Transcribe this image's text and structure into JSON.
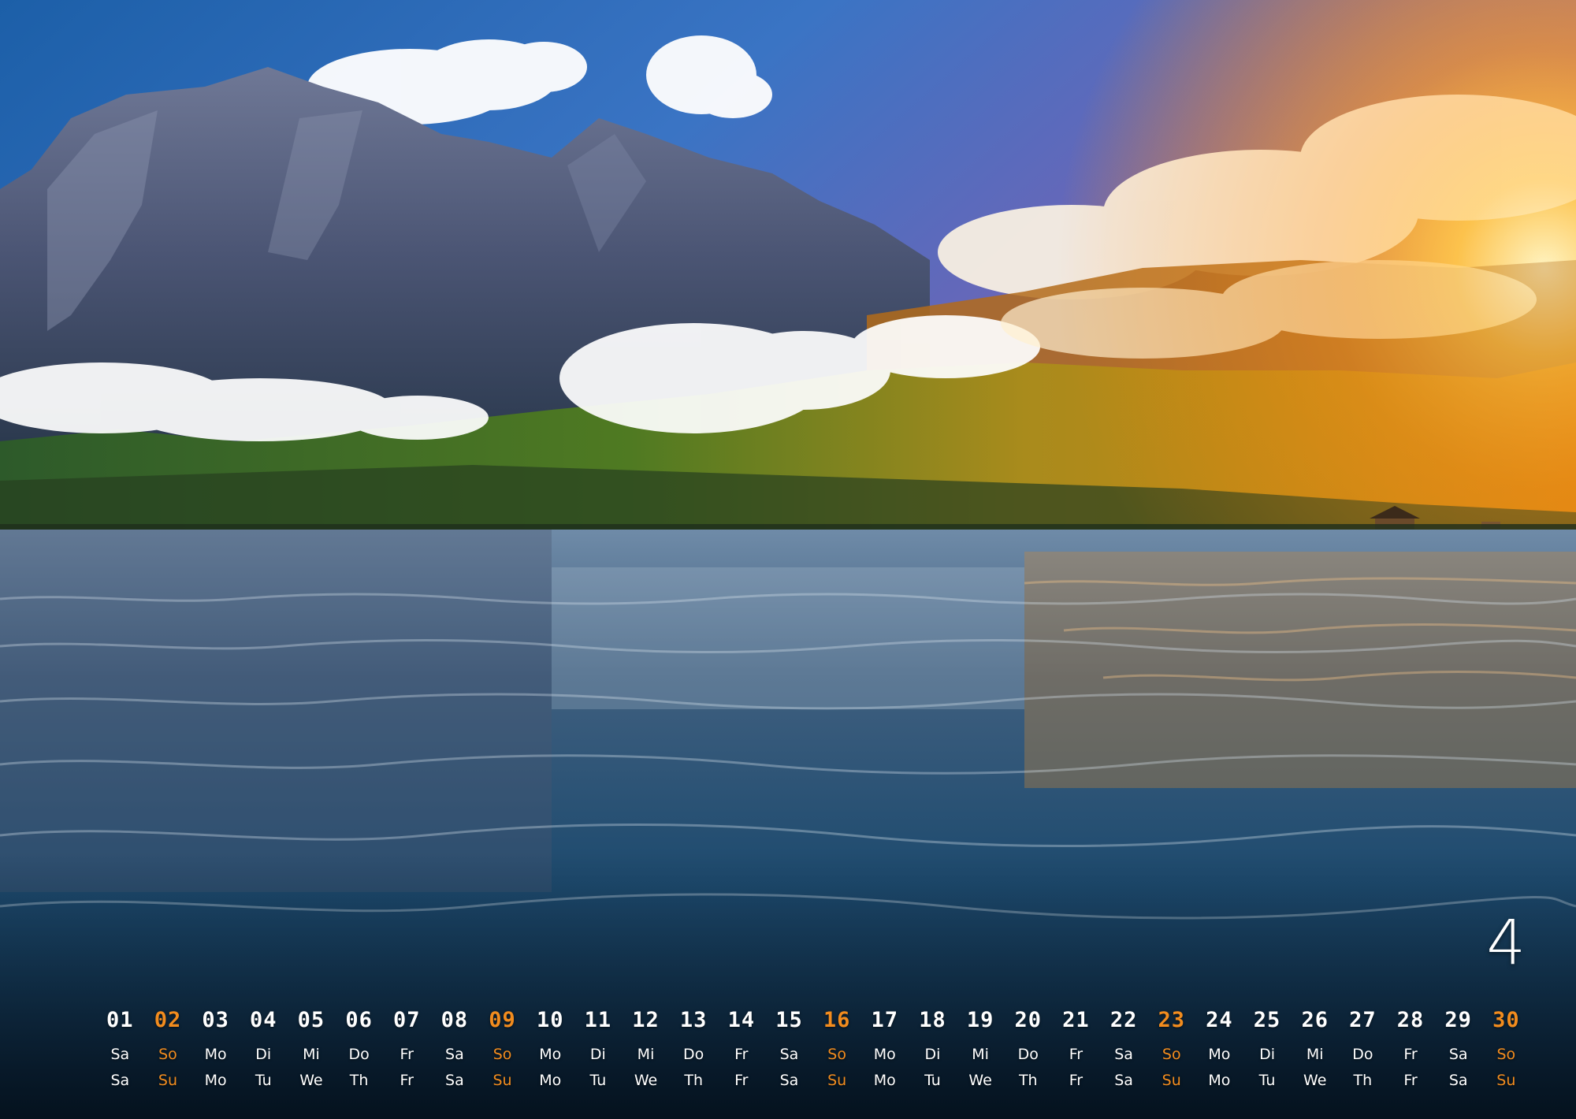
{
  "month": "4",
  "colors": {
    "weekend_accent": "#f28c1e",
    "text": "#ffffff"
  },
  "days": [
    {
      "num": "01",
      "de": "Sa",
      "en": "Sa",
      "sunday": false
    },
    {
      "num": "02",
      "de": "So",
      "en": "Su",
      "sunday": true
    },
    {
      "num": "03",
      "de": "Mo",
      "en": "Mo",
      "sunday": false
    },
    {
      "num": "04",
      "de": "Di",
      "en": "Tu",
      "sunday": false
    },
    {
      "num": "05",
      "de": "Mi",
      "en": "We",
      "sunday": false
    },
    {
      "num": "06",
      "de": "Do",
      "en": "Th",
      "sunday": false
    },
    {
      "num": "07",
      "de": "Fr",
      "en": "Fr",
      "sunday": false
    },
    {
      "num": "08",
      "de": "Sa",
      "en": "Sa",
      "sunday": false
    },
    {
      "num": "09",
      "de": "So",
      "en": "Su",
      "sunday": true
    },
    {
      "num": "10",
      "de": "Mo",
      "en": "Mo",
      "sunday": false
    },
    {
      "num": "11",
      "de": "Di",
      "en": "Tu",
      "sunday": false
    },
    {
      "num": "12",
      "de": "Mi",
      "en": "We",
      "sunday": false
    },
    {
      "num": "13",
      "de": "Do",
      "en": "Th",
      "sunday": false
    },
    {
      "num": "14",
      "de": "Fr",
      "en": "Fr",
      "sunday": false
    },
    {
      "num": "15",
      "de": "Sa",
      "en": "Sa",
      "sunday": false
    },
    {
      "num": "16",
      "de": "So",
      "en": "Su",
      "sunday": true
    },
    {
      "num": "17",
      "de": "Mo",
      "en": "Mo",
      "sunday": false
    },
    {
      "num": "18",
      "de": "Di",
      "en": "Tu",
      "sunday": false
    },
    {
      "num": "19",
      "de": "Mi",
      "en": "We",
      "sunday": false
    },
    {
      "num": "20",
      "de": "Do",
      "en": "Th",
      "sunday": false
    },
    {
      "num": "21",
      "de": "Fr",
      "en": "Fr",
      "sunday": false
    },
    {
      "num": "22",
      "de": "Sa",
      "en": "Sa",
      "sunday": false
    },
    {
      "num": "23",
      "de": "So",
      "en": "Su",
      "sunday": true
    },
    {
      "num": "24",
      "de": "Mo",
      "en": "Mo",
      "sunday": false
    },
    {
      "num": "25",
      "de": "Di",
      "en": "Tu",
      "sunday": false
    },
    {
      "num": "26",
      "de": "Mi",
      "en": "We",
      "sunday": false
    },
    {
      "num": "27",
      "de": "Do",
      "en": "Th",
      "sunday": false
    },
    {
      "num": "28",
      "de": "Fr",
      "en": "Fr",
      "sunday": false
    },
    {
      "num": "29",
      "de": "Sa",
      "en": "Sa",
      "sunday": false
    },
    {
      "num": "30",
      "de": "So",
      "en": "Su",
      "sunday": true
    }
  ]
}
